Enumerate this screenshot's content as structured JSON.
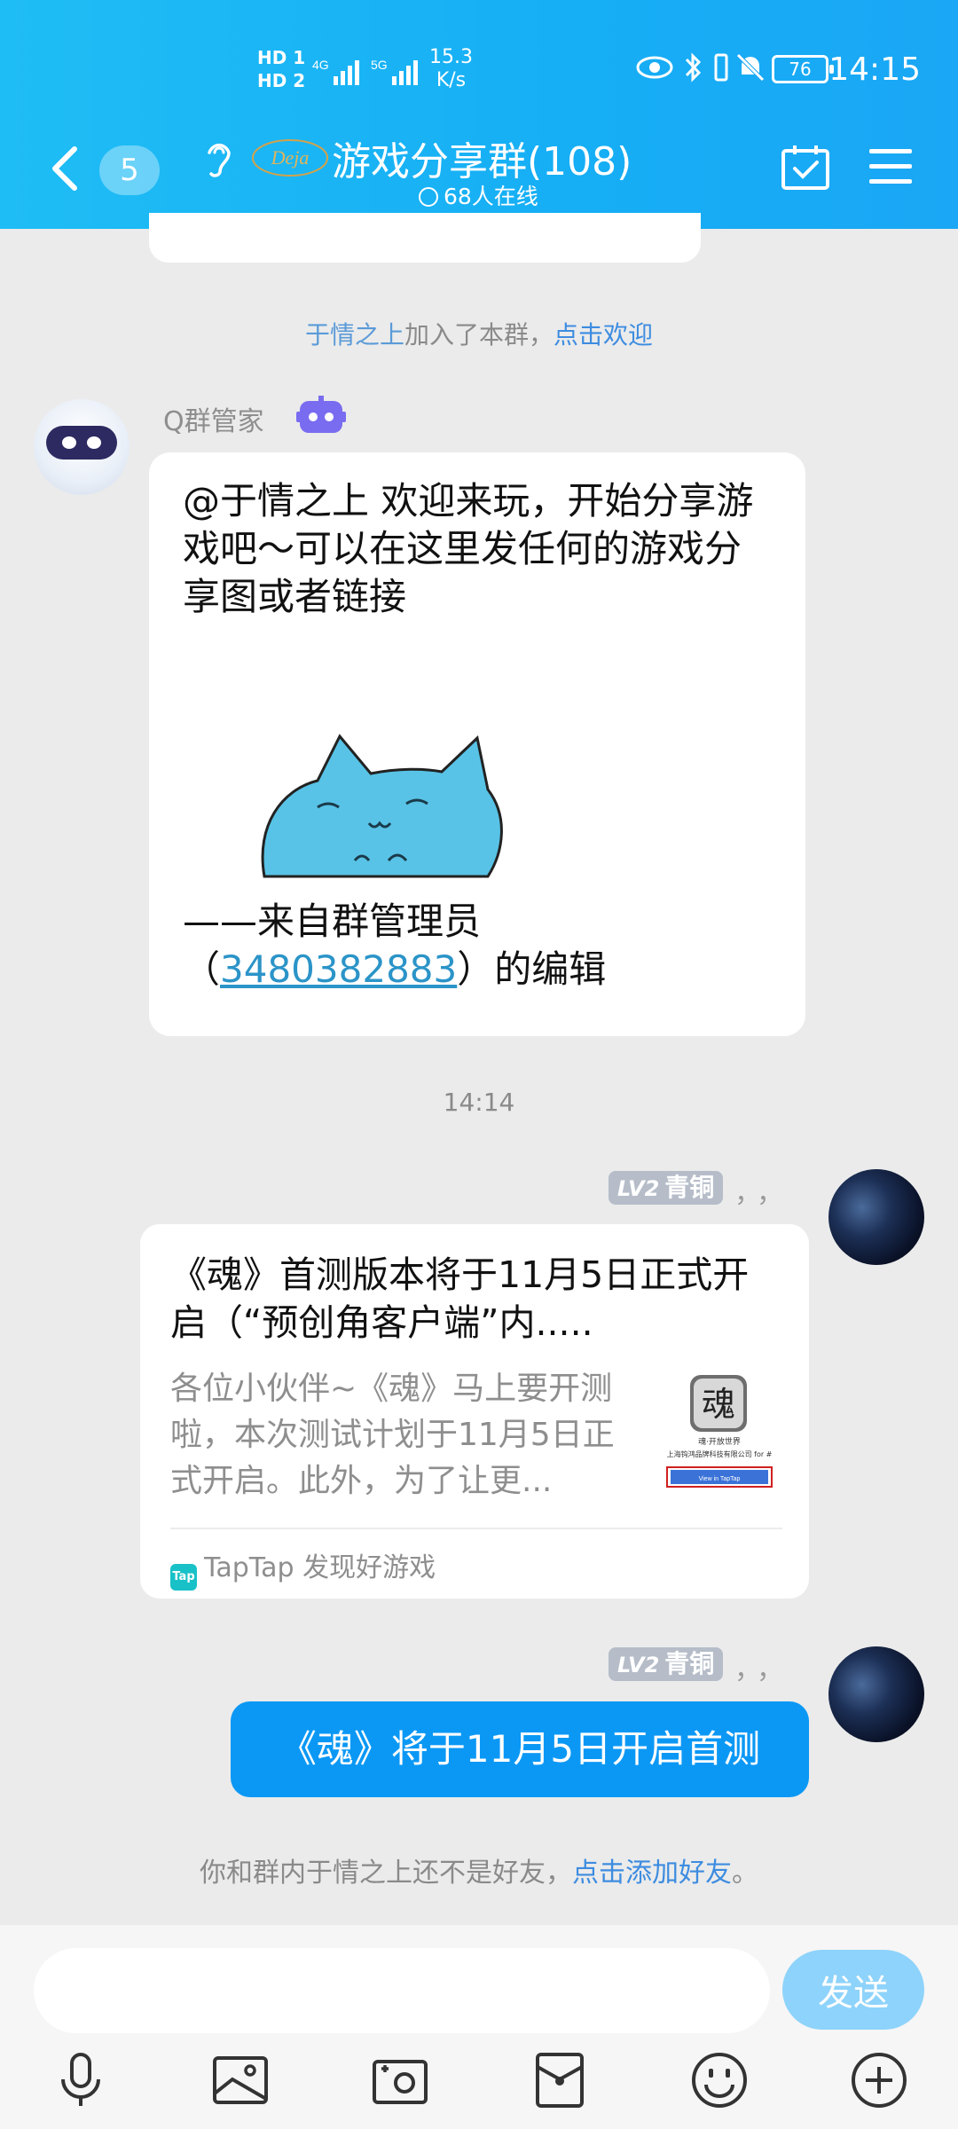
{
  "status_bar": {
    "hd1": "HD 1",
    "hd2": "HD 2",
    "net1": "4G",
    "net2": "5G",
    "speed_value": "15.3",
    "speed_unit": "K/s",
    "battery": "76",
    "time": "14:15"
  },
  "header": {
    "unread_count": "5",
    "title_logo_text": "Deja",
    "title": "游戏分享群(108)",
    "online": "68人在线"
  },
  "messages": {
    "join_name": "于情之上",
    "join_text": "加入了本群，",
    "join_welcome_link": "点击欢迎",
    "bot_name": "Q群管家",
    "welcome_text": "@于情之上 欢迎来玩，开始分享游戏吧～可以在这里发任何的游戏分享图或者链接",
    "sign_prefix": "——来自群管理员",
    "sign_open_paren": "（",
    "sign_qq": "3480382883",
    "sign_suffix": "）的编辑",
    "time_divider": "14:14",
    "rank_lv": "LV2",
    "rank_name": "青铜",
    "rank_punct": "，，",
    "card_title": "《魂》首测版本将于11月5日正式开启（“预创角客户端”内.....",
    "card_desc": "各位小伙伴~《魂》马上要开测啦，本次测试计划于11月5日正式开启。此外，为了让更...",
    "card_thumb_title": "魂·开放世界",
    "card_thumb_sub": "上海钩鸿品牌科技有限公司",
    "card_thumb_suffix": "for #",
    "card_thumb_button": "View in TapTap",
    "card_source_icon": "Tap",
    "card_source": "TapTap 发现好游戏",
    "blue_bubble": "《魂》将于11月5日开启首测",
    "friend_hint_prefix": "你和群内于情之上还不是好友，",
    "friend_hint_link": "点击添加好友",
    "friend_hint_suffix": "。"
  },
  "input": {
    "placeholder": "",
    "send_label": "发送"
  },
  "toolbar": [
    "voice-icon",
    "image-icon",
    "camera-icon",
    "red-packet-icon",
    "emoji-icon",
    "plus-icon"
  ]
}
